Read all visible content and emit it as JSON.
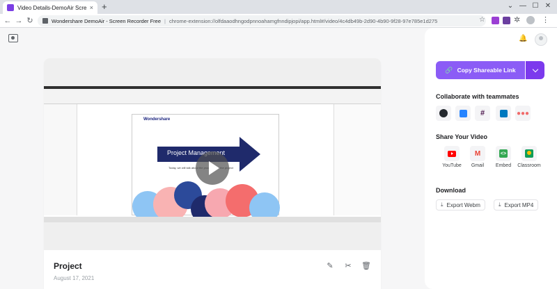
{
  "browser": {
    "tab_title": "Video Details-DemoAir Screen R...",
    "site_name": "Wondershare DemoAir - Screen Recorder Free",
    "url": "chrome-extension://olfdaaodhngodpnnoahamgfnndipjopi/app.html#/video/4c4db49b-2d90-4b90-9f28-97e785e1d275",
    "new_tab_glyph": "+",
    "close_glyph": "×",
    "minimize_glyph": "—",
    "maximize_glyph": "☐",
    "window_close_glyph": "✕",
    "back_glyph": "←",
    "forward_glyph": "→",
    "reload_glyph": "↻",
    "star_glyph": "☆",
    "puzzle_glyph": "✲",
    "menu_glyph": "⋮",
    "info_glyph": "ⓘ",
    "separator": "|",
    "extension_colors": [
      "#9b3fd4",
      "#6b3fa0"
    ]
  },
  "video_card": {
    "title": "Project",
    "date": "August 17, 2021",
    "slide_brand": "Wondershare",
    "slide_title": "Project Management",
    "slide_sub": "Today, we will talk about the procedure of the project",
    "edit_glyph": "✎",
    "scissors_glyph": "✂",
    "delete_glyph": "🗑",
    "upload_icon": "video-folder-icon"
  },
  "panel": {
    "bell_glyph": "🔔",
    "share_link_label": "Copy Shareable Link",
    "link_glyph": "🔗",
    "collab_title": "Collaborate with teammates",
    "collab_icons": [
      "github-icon",
      "jira-icon",
      "slack-icon",
      "trello-icon",
      "asana-icon"
    ],
    "slack_glyph": "#",
    "asana_glyph": "●●●",
    "share_title": "Share Your Video",
    "share_items": [
      {
        "label": "YouTube",
        "icon": "youtube-icon"
      },
      {
        "label": "Gmail",
        "icon": "gmail-icon",
        "glyph": "M"
      },
      {
        "label": "Embed",
        "icon": "embed-icon",
        "glyph": "<>"
      },
      {
        "label": "Classroom",
        "icon": "classroom-icon"
      }
    ],
    "download_title": "Download",
    "download_glyph": "⤓",
    "export_webm": "Export Webm",
    "export_mp4": "Export MP4"
  },
  "colors": {
    "accent": "#8b5cf6",
    "accent_dark": "#7c3aed",
    "slide_arrow": "#1f2a6b"
  }
}
